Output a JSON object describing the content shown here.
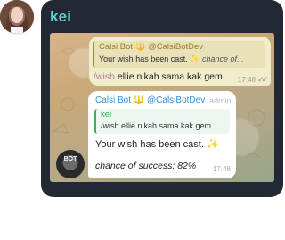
{
  "sender": {
    "name": "kei"
  },
  "screenshot": {
    "outgoing": {
      "reply_header": "Calsi Bot 🔱 @CalsiBotDev",
      "reply_text": "Your wish has been cast.",
      "reply_sparkle": "✨",
      "reply_tail": "chance of...",
      "command": "/wish",
      "text": " ellie nikah sama kak gem",
      "time": "17:48",
      "checks": "✓✓"
    },
    "incoming": {
      "header": "Calsi Bot 🔱 @CalsiBotDev",
      "badge": "admin",
      "reply_name": "kei",
      "reply_text": "/wish ellie nikah sama kak gem",
      "body_line1": "Your wish has been cast.",
      "body_sparkle": "✨",
      "body_line2": "chance of success: 82%",
      "time": "17:48"
    },
    "bot_avatar_label": "BOT"
  },
  "colors": {
    "card_bg": "#232835",
    "name_accent": "#5fd0cb",
    "bot_name": "#3a8fd1",
    "reply_green": "#3fae5b",
    "outgoing_bubble": "#f1ecc9"
  }
}
